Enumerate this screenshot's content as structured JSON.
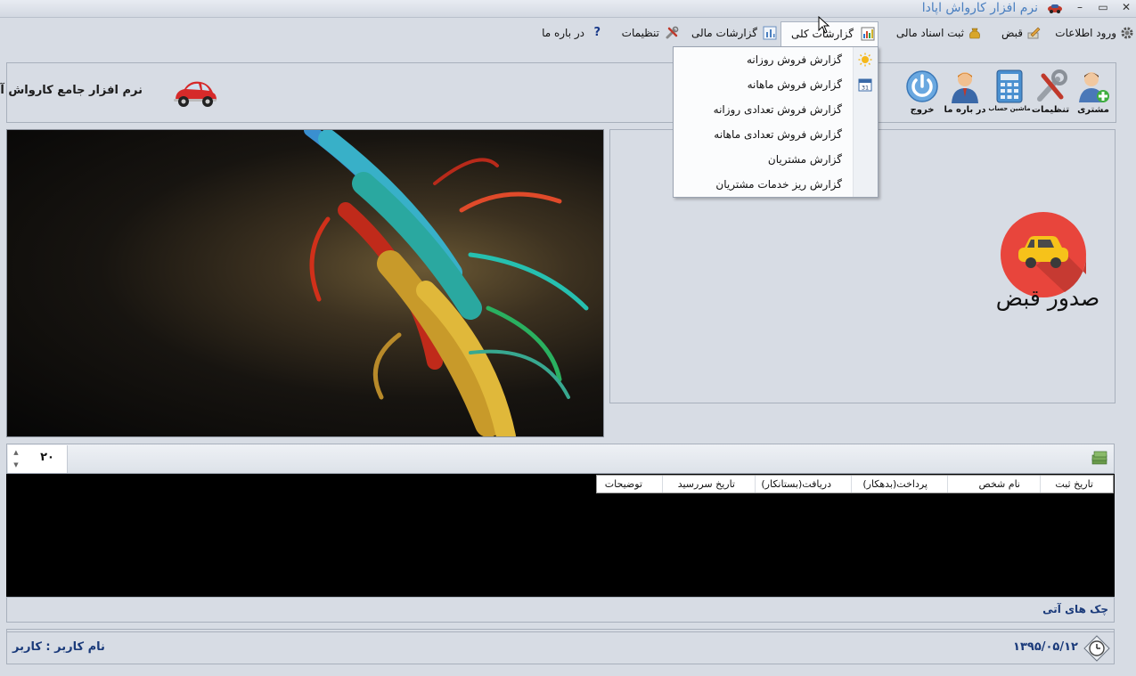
{
  "window": {
    "title": "نرم افزار کارواش اپادا",
    "minimize": "–",
    "restore": "▭",
    "close": "✕"
  },
  "menu": [
    {
      "label": "ورود اطلاعات",
      "icon": "gear-icon"
    },
    {
      "label": "قبض",
      "icon": "pencil-icon"
    },
    {
      "label": "ثبت اسناد مالی",
      "icon": "money-bag-icon"
    },
    {
      "label": "گزارشات کلی",
      "icon": "bar-chart-icon"
    },
    {
      "label": "گزارشات مالی",
      "icon": "chart-icon"
    },
    {
      "label": "تنظیمات",
      "icon": "tools-icon"
    },
    {
      "label": "در باره ما",
      "icon": "help-icon"
    }
  ],
  "help_glyph": "?",
  "dropdown": [
    "گزارش  فروش روزانه",
    "گزارش فروش ماهانه",
    "گزارش فروش تعدادی روزانه",
    "گزارش فروش تعدادی ماهانه",
    "گزارش مشتریان",
    "گزارش ریز خدمات مشتریان"
  ],
  "toolbar": {
    "heading": "نرم افزار جامع کارواش آپادا",
    "buttons": [
      {
        "label": "مشتری",
        "icon": "customer-add-icon"
      },
      {
        "label": "تنظیمات",
        "icon": "tools-icon"
      },
      {
        "label": "ماشین حساب",
        "icon": "calculator-icon"
      },
      {
        "label": "در باره ما",
        "icon": "about-person-icon"
      },
      {
        "label": "خروج",
        "icon": "power-icon"
      }
    ]
  },
  "receipt": {
    "label": "صدور قبض",
    "icon": "car-icon",
    "color": "#e8453c"
  },
  "pager": {
    "value": "۲۰",
    "up": "▲",
    "down": "▼"
  },
  "grid": {
    "columns": [
      "تاریخ ثبت",
      "نام شخص",
      "پرداخت(بدهکار)",
      "دریافت(بستانکار)",
      "تاریخ سررسید",
      "توضیحات"
    ]
  },
  "checks_label": "چک های آتی",
  "status": {
    "date": "۱۳۹۵/۰۵/۱۲",
    "user": "نام کاربر : کاربر"
  }
}
